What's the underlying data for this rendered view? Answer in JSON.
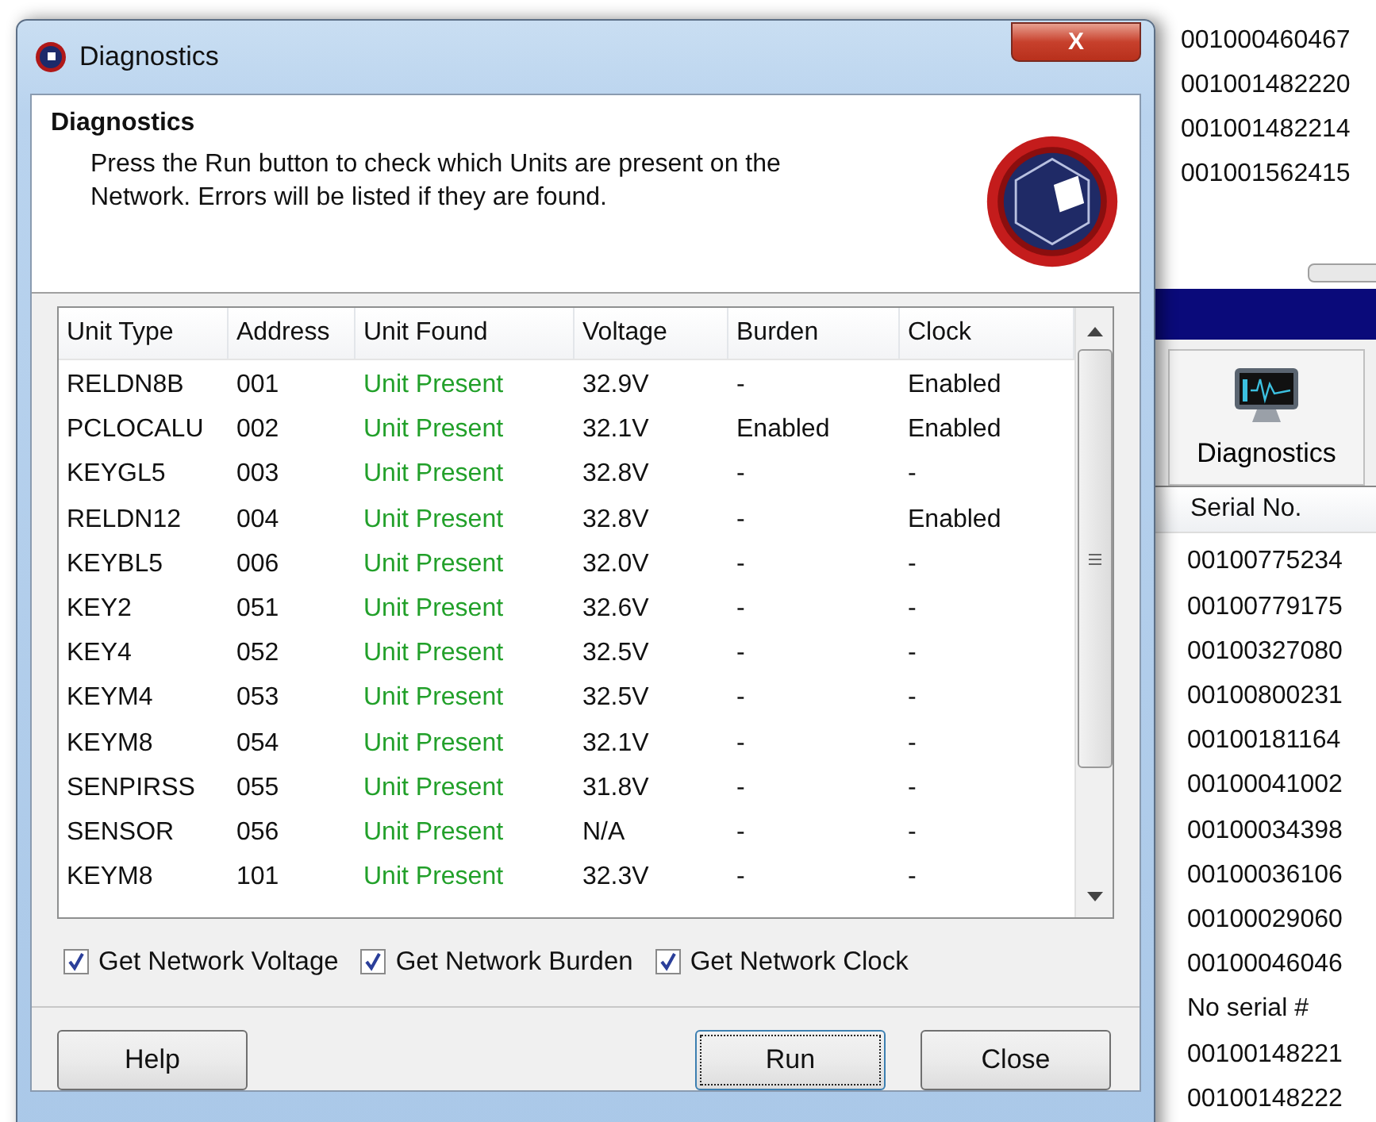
{
  "dialog": {
    "title": "Diagnostics",
    "close_label": "X",
    "header": {
      "title": "Diagnostics",
      "text": "Press the Run button to check which Units are present on the Network.  Errors will be listed if they are found."
    },
    "table": {
      "columns": [
        "Unit Type",
        "Address",
        "Unit Found",
        "Voltage",
        "Burden",
        "Clock"
      ],
      "rows": [
        [
          "RELDN8B",
          "001",
          "Unit Present",
          "32.9V",
          "-",
          "Enabled"
        ],
        [
          "PCLOCALU",
          "002",
          "Unit Present",
          "32.1V",
          "Enabled",
          "Enabled"
        ],
        [
          "KEYGL5",
          "003",
          "Unit Present",
          "32.8V",
          "-",
          "-"
        ],
        [
          "RELDN12",
          "004",
          "Unit Present",
          "32.8V",
          "-",
          "Enabled"
        ],
        [
          "KEYBL5",
          "006",
          "Unit Present",
          "32.0V",
          "-",
          "-"
        ],
        [
          "KEY2",
          "051",
          "Unit Present",
          "32.6V",
          "-",
          "-"
        ],
        [
          "KEY4",
          "052",
          "Unit Present",
          "32.5V",
          "-",
          "-"
        ],
        [
          "KEYM4",
          "053",
          "Unit Present",
          "32.5V",
          "-",
          "-"
        ],
        [
          "KEYM8",
          "054",
          "Unit Present",
          "32.1V",
          "-",
          "-"
        ],
        [
          "SENPIRSS",
          "055",
          "Unit Present",
          "31.8V",
          "-",
          "-"
        ],
        [
          "SENSOR",
          "056",
          "Unit Present",
          "N/A",
          "-",
          "-"
        ],
        [
          "KEYM8",
          "101",
          "Unit Present",
          "32.3V",
          "-",
          "-"
        ]
      ]
    },
    "options": [
      {
        "label": "Get Network Voltage",
        "checked": true
      },
      {
        "label": "Get Network Burden",
        "checked": true
      },
      {
        "label": "Get Network Clock",
        "checked": true
      }
    ],
    "buttons": [
      {
        "label": "Help",
        "default": false
      },
      {
        "label": "Run",
        "default": true
      },
      {
        "label": "Close",
        "default": false
      }
    ]
  },
  "background": {
    "top_serials": [
      "001000460467",
      "001001482220",
      "001001482214",
      "001001562415"
    ],
    "toolbar_button": "Diagnostics",
    "list_header": "Serial No.",
    "serials": [
      "00100775234",
      "00100779175",
      "00100327080",
      "00100800231",
      "00100181164",
      "00100041002",
      "00100034398",
      "00100036106",
      "00100029060",
      "00100046046",
      "No serial #",
      "00100148221",
      "00100148222"
    ]
  }
}
